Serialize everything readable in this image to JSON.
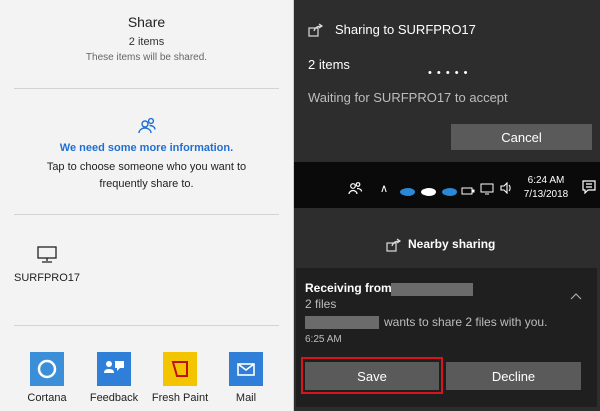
{
  "share_pane": {
    "title": "Share",
    "count": "2 items",
    "description": "These items will be shared.",
    "info_title": "We need some more information.",
    "info_desc": "Tap to choose someone who you want to frequently share to.",
    "device_name": "SURFPRO17",
    "apps": [
      {
        "label": "Cortana",
        "icon": "cortana-icon",
        "color": "#3b8fd8"
      },
      {
        "label": "Feedback",
        "icon": "feedback-icon",
        "color": "#2f7fd8"
      },
      {
        "label": "Fresh Paint",
        "icon": "fresh-paint-icon",
        "color": "#f2c500"
      },
      {
        "label": "Mail",
        "icon": "mail-icon",
        "color": "#2f7fd8"
      }
    ]
  },
  "sending": {
    "title": "Sharing to SURFPRO17",
    "count": "2 items",
    "progress": "• • • • •",
    "status": "Waiting for SURFPRO17 to accept",
    "cancel_label": "Cancel"
  },
  "taskbar": {
    "time": "6:24 AM",
    "date": "7/13/2018"
  },
  "receiving": {
    "header": "Nearby sharing",
    "title": "Receiving from",
    "files": "2 files",
    "message": "wants to share 2 files with you.",
    "time": "6:25 AM",
    "save_label": "Save",
    "decline_label": "Decline",
    "highlight_color": "#d9141d"
  },
  "colors": {
    "accent": "#1f6fd1",
    "dark_bg": "#2d2d2d",
    "button_bg": "#5a5a5a"
  }
}
